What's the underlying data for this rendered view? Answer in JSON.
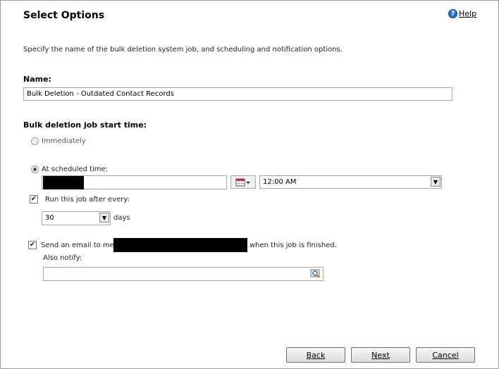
{
  "header": {
    "title": "Select Options",
    "help_label": "Help",
    "help_icon": "help-icon"
  },
  "description": "Specify the name of the bulk deletion system job, and scheduling and notification options.",
  "name_section": {
    "label": "Name:",
    "value": "Bulk Deletion - Outdated Contact Records"
  },
  "start_time": {
    "label": "Bulk deletion job start time:",
    "immediately_label": "Immediately",
    "scheduled_label": "At scheduled time:",
    "date_value": "",
    "time_value": "12:00 AM",
    "scheduled_selected": true
  },
  "recurrence": {
    "label": "Run this job after every:",
    "checked": true,
    "interval_value": "30",
    "unit_label": "days"
  },
  "email": {
    "label_before": "Send an email to me",
    "label_after": "when this job is finished.",
    "checked": true,
    "also_notify_label": "Also notify:",
    "also_notify_value": ""
  },
  "buttons": {
    "back": "Back",
    "next": "Next",
    "cancel": "Cancel"
  }
}
